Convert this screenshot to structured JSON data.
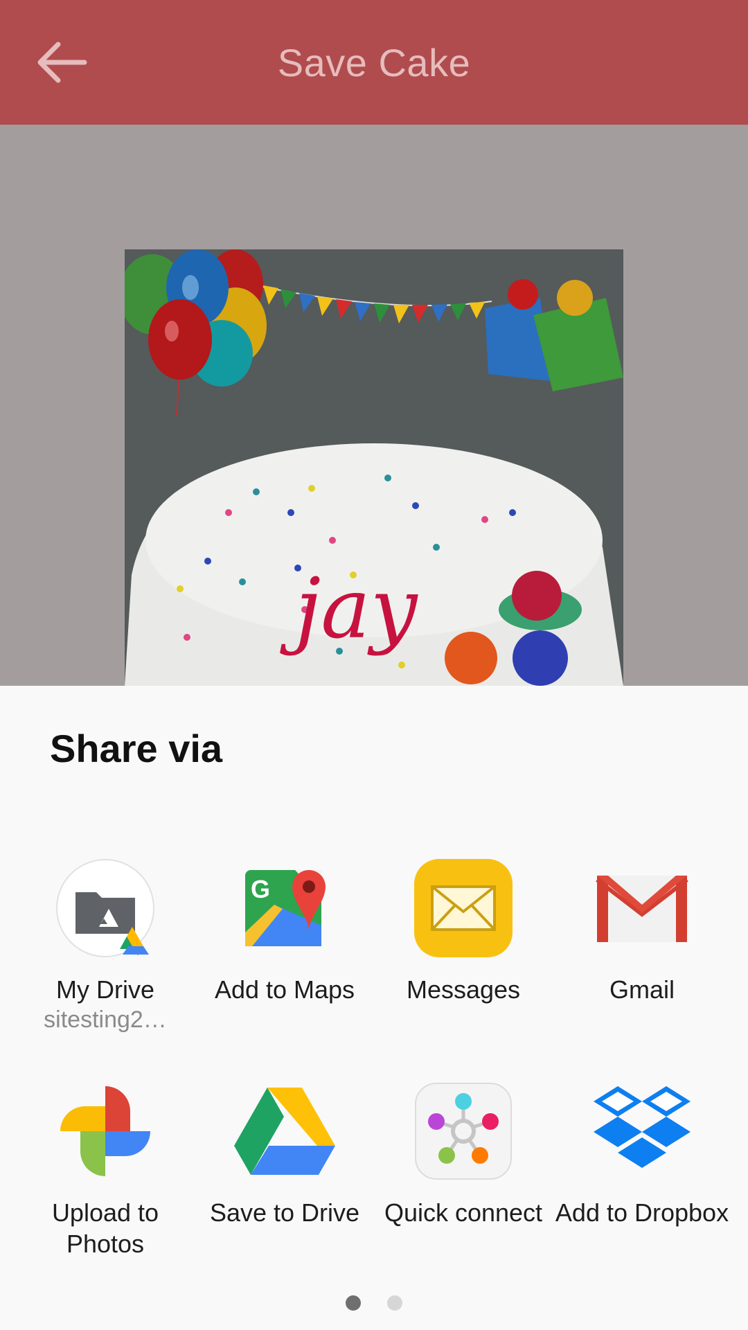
{
  "header": {
    "title": "Save Cake",
    "back_icon": "arrow-left-icon"
  },
  "preview": {
    "name_on_cake": "jay"
  },
  "share": {
    "title": "Share via",
    "apps": [
      {
        "label": "My Drive",
        "sub": "sitesting2…",
        "icon": "my-drive-icon"
      },
      {
        "label": "Add to Maps",
        "icon": "google-maps-icon"
      },
      {
        "label": "Messages",
        "icon": "messages-icon"
      },
      {
        "label": "Gmail",
        "icon": "gmail-icon"
      },
      {
        "label": "Upload to Photos",
        "icon": "google-photos-icon"
      },
      {
        "label": "Save to Drive",
        "icon": "google-drive-icon"
      },
      {
        "label": "Quick connect",
        "icon": "quick-connect-icon"
      },
      {
        "label": "Add to Dropbox",
        "icon": "dropbox-icon"
      }
    ]
  },
  "pager": {
    "pages": 2,
    "active": 1
  },
  "colors": {
    "appbar": "#b04c4e",
    "title": "#e6bcbc",
    "scrim": "#a39d9d",
    "sheet": "#f9f9f9"
  }
}
